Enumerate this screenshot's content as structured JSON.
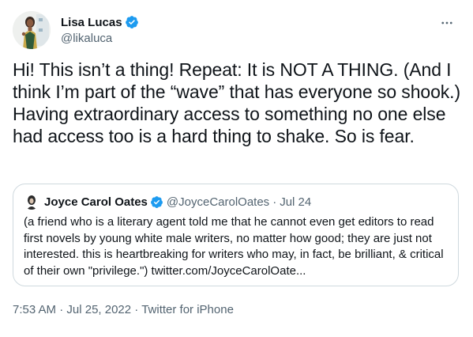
{
  "author": {
    "display_name": "Lisa Lucas",
    "handle": "@likaluca",
    "verified": true,
    "avatar_icon": "profile-photo"
  },
  "more_icon": "ellipsis-icon",
  "tweet": {
    "text": "Hi! This isn’t a thing! Repeat: It is NOT A THING. (And I think I’m part of the “wave” that has everyone so shook.) Having extraordinary access to something no one else had access too is a hard thing to shake. So is fear."
  },
  "quoted_tweet": {
    "display_name": "Joyce Carol Oates",
    "handle": "@JoyceCarolOates",
    "separator": "·",
    "date": "Jul 24",
    "verified": true,
    "text": "(a friend who is a literary agent told me that he cannot even get editors to read first novels by young white male writers, no matter how good; they are just not interested. this is heartbreaking for writers who may, in fact, be brilliant, & critical of their own \"privilege.\") twitter.com/JoyceCarolOate..."
  },
  "meta": {
    "time": "7:53 AM",
    "separator": "·",
    "date": "Jul 25, 2022",
    "source": "Twitter for iPhone"
  },
  "colors": {
    "primary_text": "#0f1419",
    "secondary_text": "#536471",
    "verified_blue": "#1d9bf0",
    "border": "#cfd9de"
  }
}
